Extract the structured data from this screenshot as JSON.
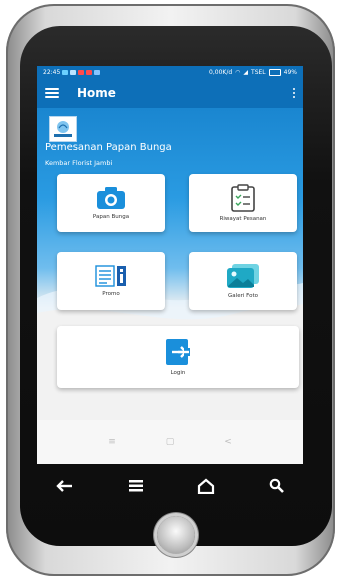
{
  "status_bar": {
    "time": "22:45",
    "speed": "0,00K/d",
    "carrier": "TSEL",
    "battery": "49%"
  },
  "app_bar": {
    "title": "Home"
  },
  "header": {
    "title": "Pemesanan Papan Bunga",
    "subtitle": "Kembar Florist Jambi",
    "logo_text": "KEMBAR"
  },
  "menu": {
    "papan_bunga": "Papan Bunga",
    "riwayat": "Riwayat Pesanan",
    "promo": "Promo",
    "galeri": "Galeri Foto",
    "login": "Login"
  },
  "nav": {
    "recents": "≡",
    "home": "▢",
    "back": "<"
  },
  "colors": {
    "primary": "#0d6fb8",
    "accent": "#1e9be9"
  }
}
